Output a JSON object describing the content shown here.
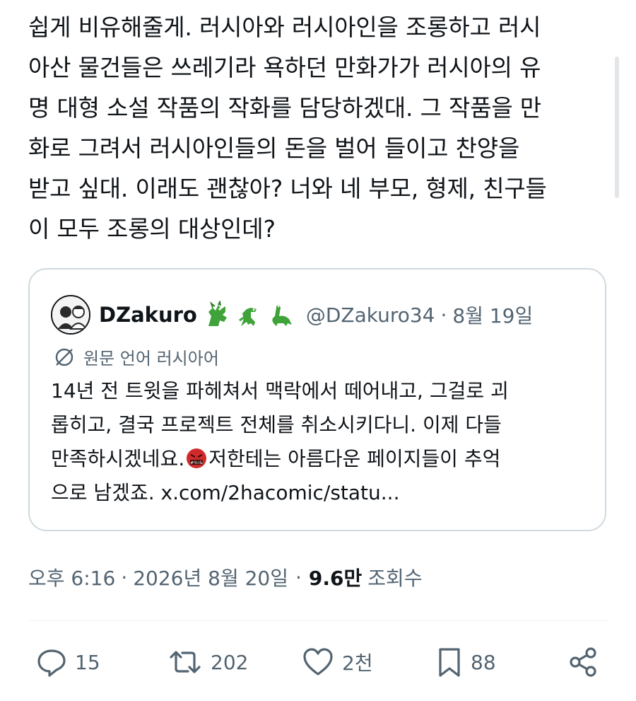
{
  "post": {
    "text": "쉽게 비유해줄게. 러시아와 러시아인을 조롱하고 러시\n아산 물건들은 쓰레기라 욕하던 만화가가 러시아의 유\n명 대형 소설 작품의 작화를 담당하겠대. 그 작품을 만\n화로 그려서 러시아인들의 돈을 벌어 들이고 찬양을\n받고 싶대. 이래도 괜찮아? 너와 네 부모, 형제, 친구들\n이 모두 조롱의 대상인데?"
  },
  "quote": {
    "display_name": "DZakuro",
    "handle": "@DZakuro34",
    "separator": "·",
    "date": "8월 19일",
    "emoji_icons": [
      "dragon-icon",
      "dinosaur-icon",
      "sauropod-icon"
    ],
    "language_note": "원문 언어 러시아어",
    "body_before_emoji": "14년 전 트윗을 파헤쳐서 맥락에서 떼어내고, 그걸로 괴\n롭히고, 결국 프로젝트 전체를 취소시키다니. 이제 다들\n만족하시겠네요.",
    "emoji_icon": "angry-face-icon",
    "body_after_emoji": "저한테는 아름다운 페이지들이 추억\n으로 남겠죠. x.com/2hacomic/statu..."
  },
  "meta": {
    "time": "오후 6:16",
    "separator1": "·",
    "date": "2026년 8월 20일",
    "separator2": "·",
    "views": "9.6만",
    "views_label": "조회수"
  },
  "actions": {
    "reply_count": "15",
    "retweet_count": "202",
    "like_count": "2천",
    "bookmark_count": "88"
  },
  "colors": {
    "text": "#0f1419",
    "secondary": "#536471",
    "border": "#cfd9de",
    "green": "#3fa33a"
  }
}
